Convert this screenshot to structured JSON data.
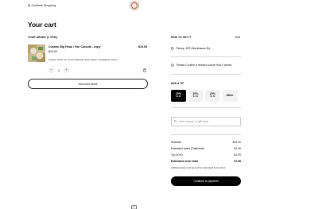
{
  "header": {
    "back_label": "Continue Shopping",
    "logo_icon": "shop-logo"
  },
  "page": {
    "title": "Your cart"
  },
  "order": {
    "section_label": "YOUR ORDER (1 ITEM)",
    "items": [
      {
        "name": "Custom Big Head / Fan Cutouts - copy",
        "unit_price": "$19.00",
        "variant": "Custom Order: for Jenna Villarreal, Style Option: Graduation Layout",
        "total": "$19.00",
        "quantity": "1",
        "thumbnail_icon": "product-thumbnail"
      }
    ],
    "add_more_label": "Add more items"
  },
  "fulfillment": {
    "section_label": "HOW TO GET IT",
    "edit_label": "Edit",
    "pickup_text": "Pickup, 2871 Buckhaven Rd",
    "confirm_text": "Please Confirm if needed sooner that 2 weeks"
  },
  "tip": {
    "section_label": "ADD A TIP",
    "options": [
      {
        "pct": "10%",
        "amount": "$1.90",
        "selected": true
      },
      {
        "pct": "10%",
        "amount": "$1.90",
        "selected": false
      },
      {
        "pct": "20%",
        "amount": "$3.80",
        "selected": false
      },
      {
        "pct": "Other",
        "amount": "",
        "selected": false
      }
    ]
  },
  "coupon": {
    "placeholder": "Add coupon or gift card"
  },
  "summary": {
    "rows": [
      {
        "label": "Subtotal",
        "value": "$19.00"
      },
      {
        "label": "Estimated taxes (California)",
        "value": "$1.16"
      },
      {
        "label": "Tip (10%)",
        "value": "$1.90"
      },
      {
        "label": "Estimated order total",
        "value": "$7.66"
      }
    ],
    "tax_note": "Additional taxes and fees will be calculated at checkout",
    "pay_label": "Continue to payment"
  },
  "colors": {
    "accent": "#000000",
    "tip_bg": "#f2f2f2",
    "divider": "#dddddd"
  }
}
